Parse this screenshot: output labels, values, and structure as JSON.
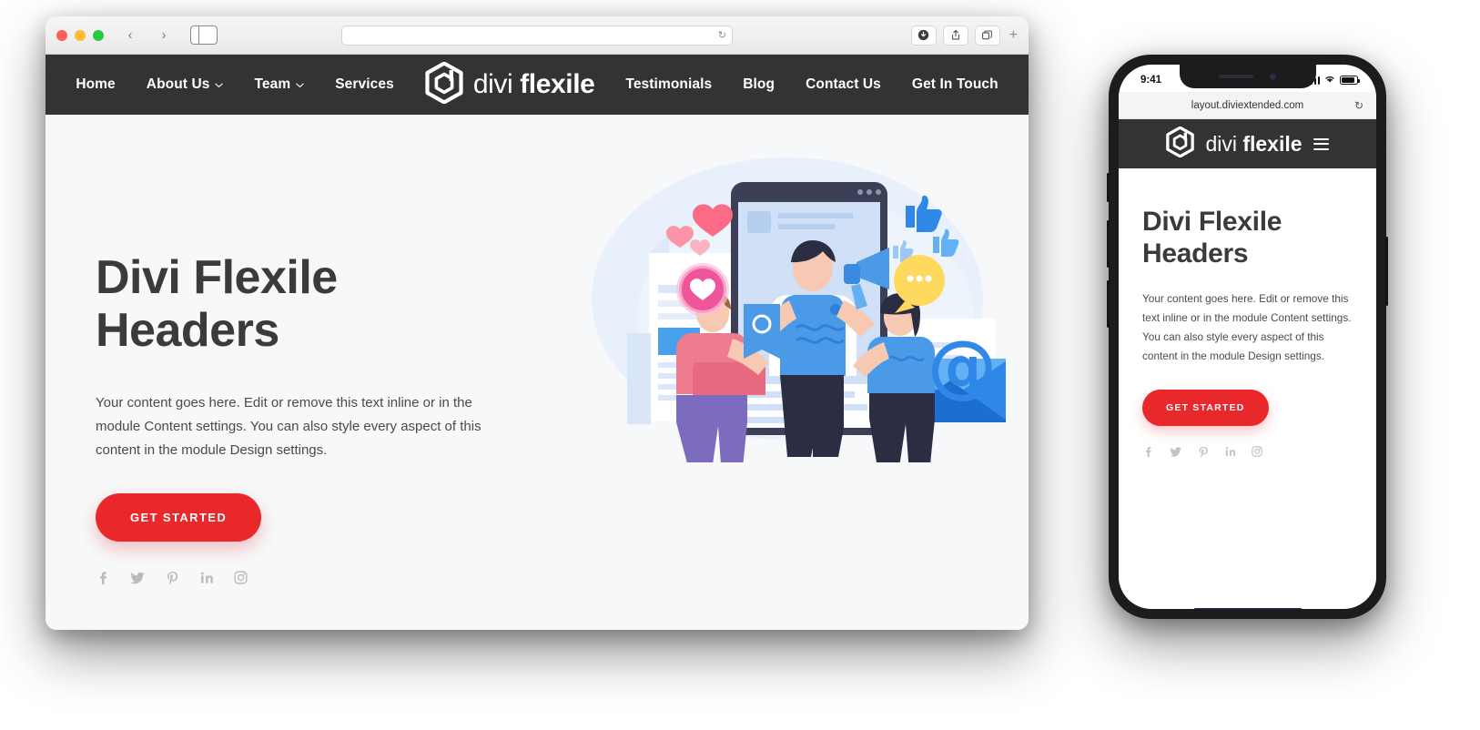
{
  "browser": {
    "traffic_lights": [
      "close",
      "minimize",
      "maximize"
    ],
    "back_label": "‹",
    "forward_label": "›",
    "url_value": "",
    "reload_label": "↻",
    "download_label": "⬇",
    "share_label": "⇧",
    "tabs_label": "⧉",
    "new_tab_label": "+"
  },
  "site": {
    "logo_text_light": "divi ",
    "logo_text_bold": "flexile",
    "nav_left": [
      {
        "label": "Home",
        "has_dropdown": false
      },
      {
        "label": "About Us",
        "has_dropdown": true
      },
      {
        "label": "Team",
        "has_dropdown": true
      },
      {
        "label": "Services",
        "has_dropdown": false
      }
    ],
    "nav_right": [
      {
        "label": "Testimonials",
        "has_dropdown": false
      },
      {
        "label": "Blog",
        "has_dropdown": false
      },
      {
        "label": "Contact Us",
        "has_dropdown": false
      },
      {
        "label": "Get In Touch",
        "has_dropdown": false
      }
    ],
    "hero": {
      "title_line1": "Divi Flexile",
      "title_line2": "Headers",
      "body": "Your content goes here. Edit or remove this text inline or in the module Content settings. You can also style every aspect of this content in the module Design settings.",
      "cta_label": "GET STARTED",
      "socials": [
        "facebook",
        "twitter",
        "pinterest",
        "linkedin",
        "instagram"
      ]
    },
    "chevron_glyph": "⌄"
  },
  "phone": {
    "status_time": "9:41",
    "url": "layout.diviextended.com",
    "reload_label": "↻",
    "logo_text_light": "divi ",
    "logo_text_bold": "flexile",
    "menu_label": "menu",
    "hero": {
      "title_line1": "Divi Flexile",
      "title_line2": "Headers",
      "body": "Your content goes here. Edit or remove this text inline or in the module Content settings. You can also style every aspect of this content in the module Design settings.",
      "cta_label": "GET STARTED",
      "socials": [
        "facebook",
        "twitter",
        "pinterest",
        "linkedin",
        "instagram"
      ]
    }
  },
  "colors": {
    "header_bg": "#333333",
    "accent_red": "#e8282b",
    "page_bg": "#f7f8f9",
    "heading": "#3b3b3b"
  }
}
